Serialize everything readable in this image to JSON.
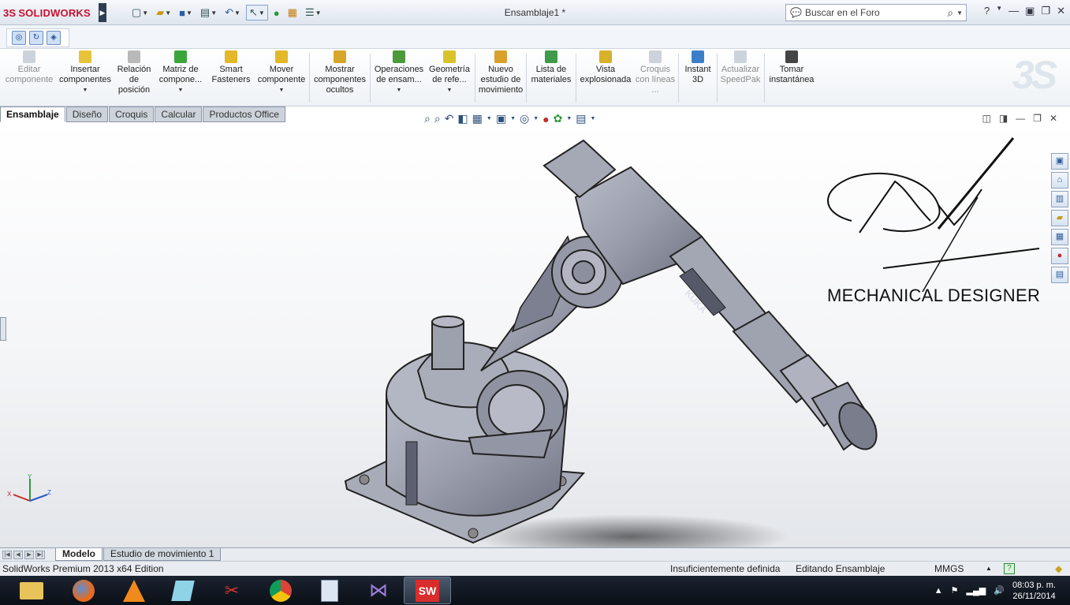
{
  "app": {
    "brand": "SOLIDWORKS",
    "document_title": "Ensamblaje1 *",
    "search_placeholder": "Buscar en el Foro"
  },
  "command_manager": [
    {
      "label": "Editar componente",
      "disabled": true,
      "icon": "edit-component-icon"
    },
    {
      "label": "Insertar componentes",
      "icon": "insert-components-icon",
      "dropdown": true
    },
    {
      "label": "Relación de posición",
      "icon": "mate-icon"
    },
    {
      "label": "Matriz de compone...",
      "icon": "component-pattern-icon",
      "dropdown": true
    },
    {
      "label": "Smart Fasteners",
      "icon": "smart-fasteners-icon"
    },
    {
      "label": "Mover componente",
      "icon": "move-component-icon",
      "dropdown": true
    },
    {
      "label": "Mostrar componentes ocultos",
      "icon": "show-hidden-components-icon"
    },
    {
      "label": "Operaciones de ensam...",
      "icon": "assembly-features-icon",
      "dropdown": true
    },
    {
      "label": "Geometría de refe...",
      "icon": "reference-geometry-icon",
      "dropdown": true
    },
    {
      "label": "Nuevo estudio de movimiento",
      "icon": "new-motion-study-icon"
    },
    {
      "label": "Lista de materiales",
      "icon": "bill-of-materials-icon"
    },
    {
      "label": "Vista explosionada",
      "icon": "exploded-view-icon"
    },
    {
      "label": "Croquis con líneas ...",
      "disabled": true,
      "icon": "explode-line-sketch-icon"
    },
    {
      "label": "Instant 3D",
      "icon": "instant-3d-icon"
    },
    {
      "label": "Actualizar SpeedPak",
      "disabled": true,
      "icon": "update-speedpak-icon"
    },
    {
      "label": "Tomar instantánea",
      "icon": "take-snapshot-icon"
    }
  ],
  "tabs": [
    "Ensamblaje",
    "Diseño",
    "Croquis",
    "Calcular",
    "Productos Office"
  ],
  "active_tab": "Ensamblaje",
  "viewport": {
    "watermark_text": "MECHANICAL DESIGNER",
    "robot_brand": "KUKA",
    "triad": {
      "x": "X",
      "y": "Y",
      "z": "Z"
    }
  },
  "bottom_tabs": [
    "Modelo",
    "Estudio de movimiento 1"
  ],
  "status": {
    "edition": "SolidWorks Premium 2013 x64 Edition",
    "definition": "Insuficientemente definida",
    "mode": "Editando Ensamblaje",
    "units": "MMGS"
  },
  "taskbar": {
    "time": "08:03 p. m.",
    "date": "26/11/2014"
  }
}
